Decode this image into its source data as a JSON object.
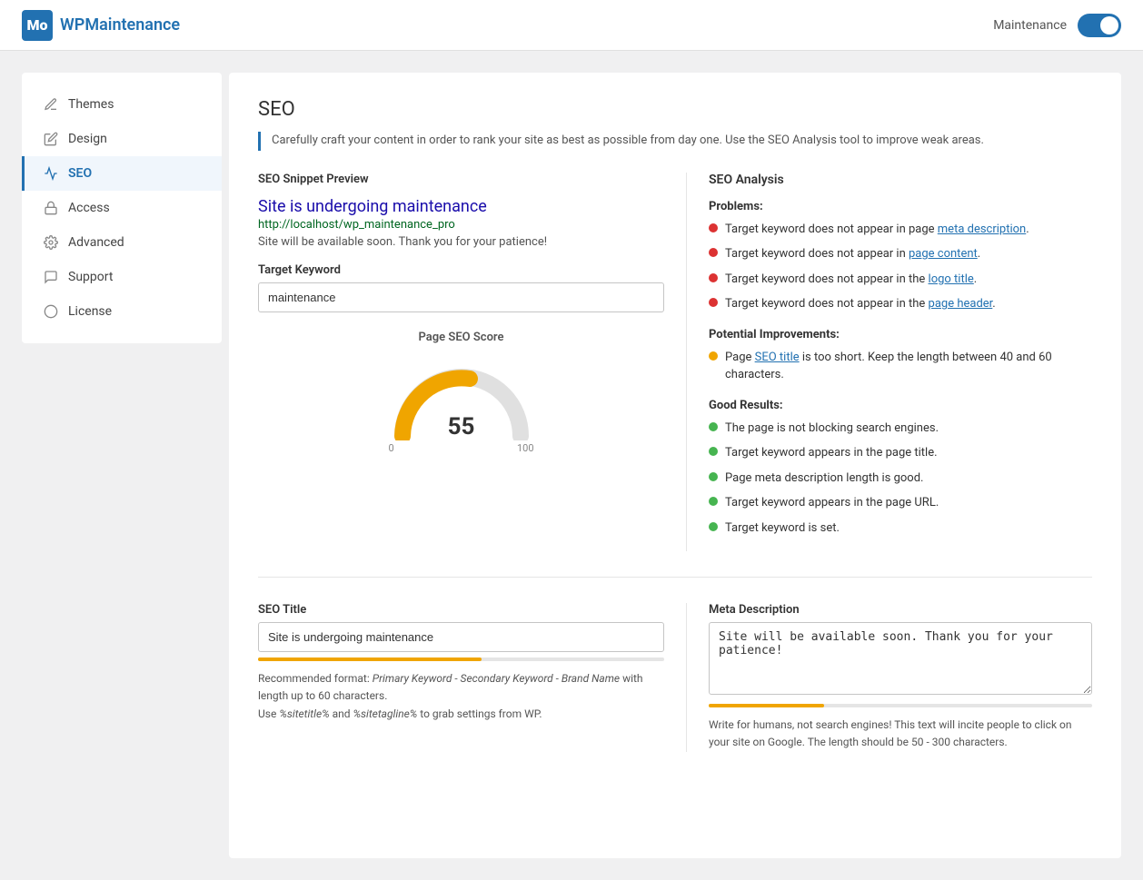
{
  "header": {
    "logo_letters": "Mo",
    "logo_wp": "WP",
    "logo_maintenance": "Maintenance",
    "maintenance_label": "Maintenance",
    "toggle_state": true
  },
  "sidebar": {
    "items": [
      {
        "id": "themes",
        "label": "Themes",
        "icon": "🎨",
        "active": false
      },
      {
        "id": "design",
        "label": "Design",
        "icon": "✏️",
        "active": false
      },
      {
        "id": "seo",
        "label": "SEO",
        "icon": "📈",
        "active": true
      },
      {
        "id": "access",
        "label": "Access",
        "icon": "🔒",
        "active": false
      },
      {
        "id": "advanced",
        "label": "Advanced",
        "icon": "⚙️",
        "active": false
      },
      {
        "id": "support",
        "label": "Support",
        "icon": "💬",
        "active": false
      },
      {
        "id": "license",
        "label": "License",
        "icon": "🔑",
        "active": false
      }
    ]
  },
  "main": {
    "page_title": "SEO",
    "page_description": "Carefully craft your content in order to rank your site as best as possible from day one. Use the SEO Analysis tool to improve weak areas.",
    "snippet_preview": {
      "section_label": "SEO Snippet Preview",
      "site_title": "Site is undergoing maintenance",
      "url": "http://localhost/wp_maintenance_pro",
      "description": "Site will be available soon. Thank you for your patience!"
    },
    "target_keyword": {
      "label": "Target Keyword",
      "value": "maintenance",
      "placeholder": "maintenance"
    },
    "page_seo_score": {
      "label": "Page SEO Score",
      "value": 55,
      "min": 0,
      "max": 100
    },
    "seo_analysis": {
      "section_label": "SEO Analysis",
      "problems_label": "Problems:",
      "problems": [
        {
          "text": "Target keyword does not appear in page ",
          "link_text": "meta description",
          "link_href": "#",
          "after": "."
        },
        {
          "text": "Target keyword does not appear in ",
          "link_text": "page content",
          "link_href": "#",
          "after": "."
        },
        {
          "text": "Target keyword does not appear in the ",
          "link_text": "logo title",
          "link_href": "#",
          "after": "."
        },
        {
          "text": "Target keyword does not appear in the ",
          "link_text": "page header",
          "link_href": "#",
          "after": "."
        }
      ],
      "improvements_label": "Potential Improvements:",
      "improvements": [
        {
          "text": "Page ",
          "link_text": "SEO title",
          "link_href": "#",
          "after": " is too short. Keep the length between 40 and 60 characters."
        }
      ],
      "good_label": "Good Results:",
      "good_results": [
        "The page is not blocking search engines.",
        "Target keyword appears in the page title.",
        "Page meta description length is good.",
        "Target keyword appears in the page URL.",
        "Target keyword is set."
      ]
    },
    "seo_title": {
      "label": "SEO Title",
      "value": "Site is undergoing maintenance",
      "placeholder": "Site is undergoing maintenance",
      "format_hint_line1": "Recommended format: ",
      "format_hint_italic": "Primary Keyword - Secondary Keyword - Brand Name",
      "format_hint_line2": " with length up to 60 characters.",
      "format_hint_line3": "Use ",
      "format_hint_italic2": "%sitetitle%",
      "format_hint_and": " and ",
      "format_hint_italic3": "%sitetagline%",
      "format_hint_line4": " to grab settings from WP."
    },
    "meta_description": {
      "label": "Meta Description",
      "value": "Site will be available soon. Thank you for your patience!",
      "placeholder": "Site will be available soon. Thank you for your patience!",
      "hint": "Write for humans, not search engines! This text will incite people to click on your site on Google. The length should be 50 - 300 characters."
    }
  }
}
